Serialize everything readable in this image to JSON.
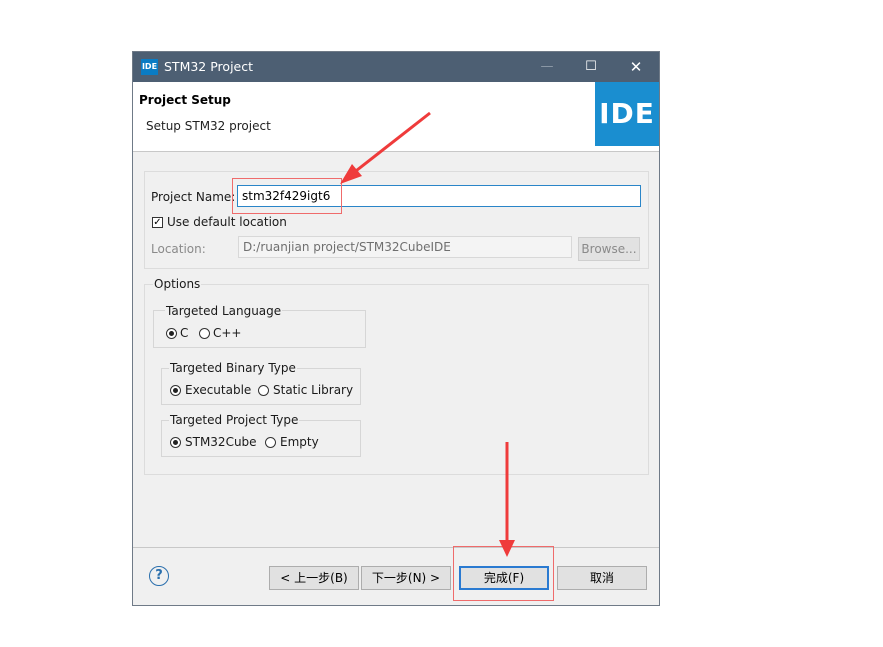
{
  "window": {
    "icon_text": "IDE",
    "title": "STM32 Project",
    "minimize": "—",
    "maximize": "☐",
    "close": "✕"
  },
  "banner": {
    "title": "Project Setup",
    "subtitle": "Setup STM32 project",
    "logo_text": "IDE"
  },
  "project": {
    "name_label": "Project Name:",
    "name_value": "stm32f429igt6",
    "default_location_label": "Use default location",
    "default_location_checked": true,
    "location_label": "Location:",
    "location_value": "D:/ruanjian project/STM32CubeIDE",
    "browse_label": "Browse..."
  },
  "options": {
    "title": "Options",
    "language": {
      "title": "Targeted Language",
      "options": [
        "C",
        "C++"
      ],
      "selected": "C"
    },
    "binary": {
      "title": "Targeted Binary Type",
      "options": [
        "Executable",
        "Static Library"
      ],
      "selected": "Executable"
    },
    "project_type": {
      "title": "Targeted Project Type",
      "options": [
        "STM32Cube",
        "Empty"
      ],
      "selected": "STM32Cube"
    }
  },
  "footer": {
    "help_icon": "?",
    "back_label": "< 上一步(B)",
    "next_label": "下一步(N) >",
    "finish_label": "完成(F)",
    "cancel_label": "取消"
  },
  "colors": {
    "titlebar": "#4d5f73",
    "logo": "#1a8ed0",
    "annotation": "#ef3b3b"
  }
}
